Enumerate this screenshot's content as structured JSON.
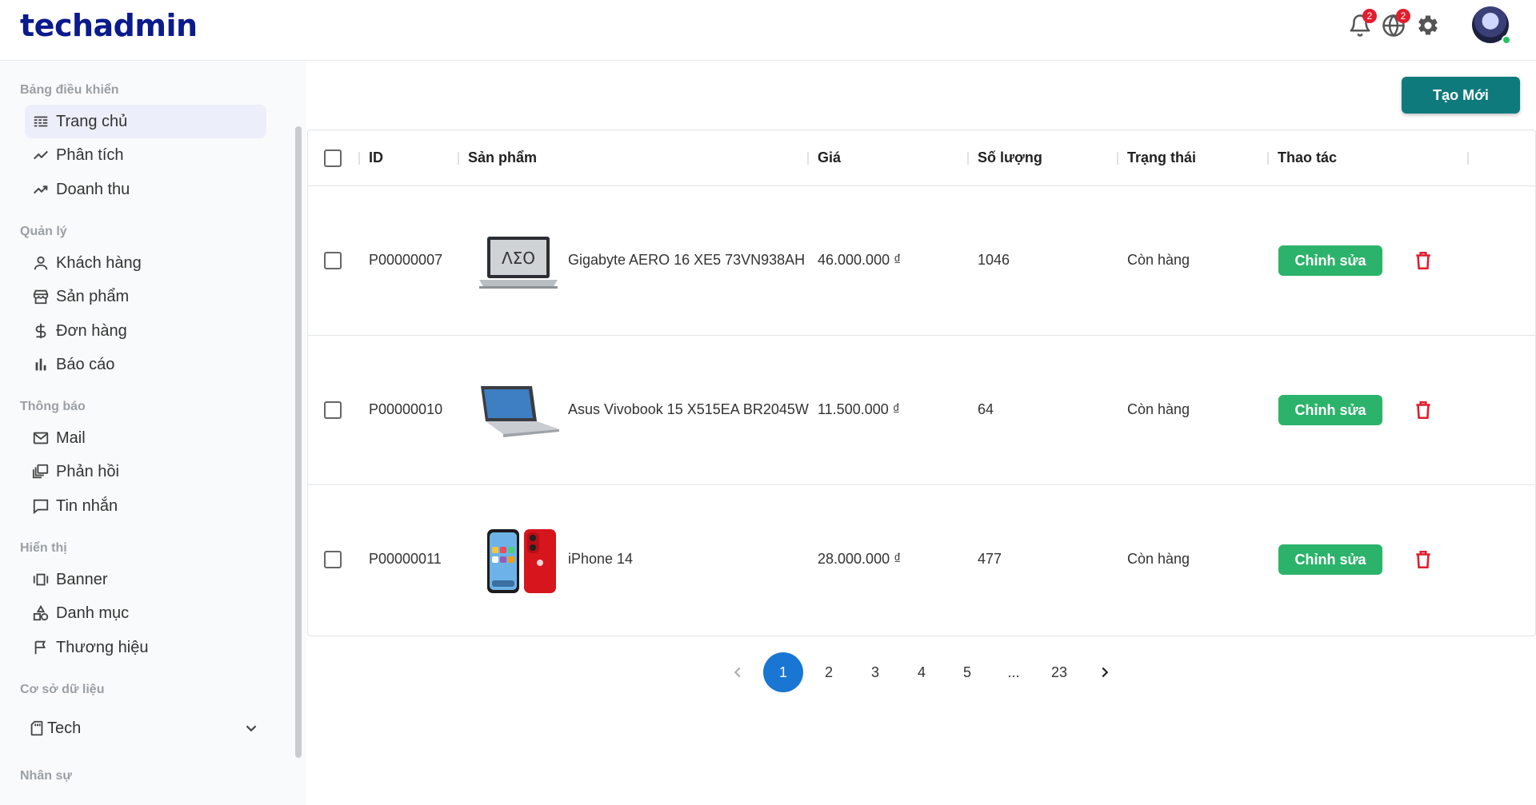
{
  "header": {
    "logo": "techadmin",
    "notifications_count": "2",
    "language_count": "2"
  },
  "sidebar": {
    "sections": [
      {
        "title": "Bảng điều khiển",
        "items": [
          {
            "label": "Trang chủ",
            "icon": "dashboard-icon"
          },
          {
            "label": "Phân tích",
            "icon": "chart-line-icon"
          },
          {
            "label": "Doanh thu",
            "icon": "trending-up-icon"
          }
        ]
      },
      {
        "title": "Quản lý",
        "items": [
          {
            "label": "Khách hàng",
            "icon": "user-icon"
          },
          {
            "label": "Sản phẩm",
            "icon": "store-icon"
          },
          {
            "label": "Đơn hàng",
            "icon": "dollar-icon"
          },
          {
            "label": "Báo cáo",
            "icon": "bar-chart-icon"
          }
        ]
      },
      {
        "title": "Thông báo",
        "items": [
          {
            "label": "Mail",
            "icon": "mail-icon"
          },
          {
            "label": "Phản hồi",
            "icon": "feedback-icon"
          },
          {
            "label": "Tin nhắn",
            "icon": "message-icon"
          }
        ]
      },
      {
        "title": "Hiển thị",
        "items": [
          {
            "label": "Banner",
            "icon": "banner-icon"
          },
          {
            "label": "Danh mục",
            "icon": "category-icon"
          },
          {
            "label": "Thương hiệu",
            "icon": "flag-icon"
          }
        ]
      },
      {
        "title": "Cơ sở dữ liệu"
      },
      {
        "title": "Nhân sự"
      }
    ],
    "database": {
      "selected": "Tech"
    }
  },
  "toolbar": {
    "create_label": "Tạo Mới"
  },
  "table": {
    "columns": [
      "ID",
      "Sản phẩm",
      "Giá",
      "Số lượng",
      "Trạng thái",
      "Thao tác"
    ],
    "rows": [
      {
        "id": "P00000007",
        "product": "Gigabyte AERO 16 XE5 73VN938AH",
        "price": "46.000.000 ₫",
        "qty": "1046",
        "status": "Còn hàng",
        "edit": "Chỉnh sửa"
      },
      {
        "id": "P00000010",
        "product": "Asus Vivobook 15 X515EA BR2045W",
        "price": "11.500.000 ₫",
        "qty": "64",
        "status": "Còn hàng",
        "edit": "Chỉnh sửa"
      },
      {
        "id": "P00000011",
        "product": "iPhone 14",
        "price": "28.000.000 ₫",
        "qty": "477",
        "status": "Còn hàng",
        "edit": "Chỉnh sửa"
      }
    ]
  },
  "pagination": {
    "pages": [
      "1",
      "2",
      "3",
      "4",
      "5",
      "...",
      "23"
    ],
    "current": "1"
  },
  "colors": {
    "brand": "#0b1a8c",
    "create_button": "#0f7a7c",
    "edit_button": "#2cb36b",
    "delete": "#e11d2e",
    "page_active": "#1976d2"
  }
}
